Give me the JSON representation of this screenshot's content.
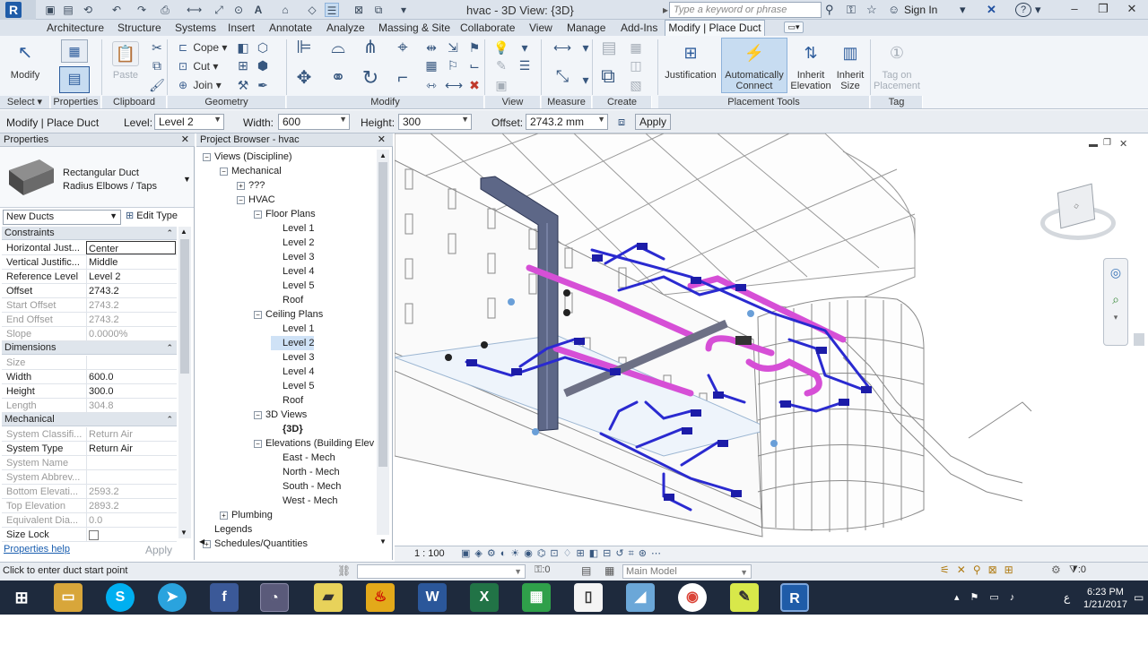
{
  "titlebar": {
    "title": "hvac - 3D View: {3D}",
    "search_placeholder": "Type a keyword or phrase",
    "signin": "Sign In",
    "help": "?"
  },
  "tabs": [
    "Architecture",
    "Structure",
    "Systems",
    "Insert",
    "Annotate",
    "Analyze",
    "Massing & Site",
    "Collaborate",
    "View",
    "Manage",
    "Add-Ins",
    "Modify | Place Duct"
  ],
  "ribbon": {
    "select": {
      "modify": "Modify",
      "panel": "Select"
    },
    "properties_panel": "Properties",
    "clipboard": {
      "paste": "Paste",
      "panel": "Clipboard"
    },
    "geometry": {
      "cope": "Cope",
      "cut": "Cut",
      "join": "Join",
      "panel": "Geometry"
    },
    "modify_panel": "Modify",
    "view_panel": "View",
    "measure_panel": "Measure",
    "create_panel": "Create",
    "placement": {
      "justification": "Justification",
      "auto_connect_1": "Automatically",
      "auto_connect_2": "Connect",
      "inherit_elev_1": "Inherit",
      "inherit_elev_2": "Elevation",
      "inherit_size_1": "Inherit",
      "inherit_size_2": "Size",
      "panel": "Placement Tools"
    },
    "tag": {
      "tag_1": "Tag on",
      "tag_2": "Placement",
      "panel": "Tag"
    }
  },
  "options": {
    "context": "Modify | Place Duct",
    "level_label": "Level:",
    "level": "Level 2",
    "width_label": "Width:",
    "width": "600",
    "height_label": "Height:",
    "height": "300",
    "offset_label": "Offset:",
    "offset": "2743.2 mm",
    "apply": "Apply"
  },
  "properties": {
    "title": "Properties",
    "type_line1": "Rectangular Duct",
    "type_line2": "Radius Elbows / Taps",
    "instance": "New Ducts",
    "edit_type": "Edit Type",
    "groups": [
      {
        "name": "Constraints",
        "rows": [
          {
            "k": "Horizontal Just...",
            "v": "Center"
          },
          {
            "k": "Vertical Justific...",
            "v": "Middle"
          },
          {
            "k": "Reference Level",
            "v": "Level 2"
          },
          {
            "k": "Offset",
            "v": "2743.2"
          },
          {
            "k": "Start Offset",
            "v": "2743.2"
          },
          {
            "k": "End Offset",
            "v": "2743.2"
          },
          {
            "k": "Slope",
            "v": "0.0000%"
          }
        ]
      },
      {
        "name": "Dimensions",
        "rows": [
          {
            "k": "Size",
            "v": ""
          },
          {
            "k": "Width",
            "v": "600.0"
          },
          {
            "k": "Height",
            "v": "300.0"
          },
          {
            "k": "Length",
            "v": "304.8"
          }
        ]
      },
      {
        "name": "Mechanical",
        "rows": [
          {
            "k": "System Classifi...",
            "v": "Return Air"
          },
          {
            "k": "System Type",
            "v": "Return Air"
          },
          {
            "k": "System Name",
            "v": ""
          },
          {
            "k": "System Abbrev...",
            "v": ""
          },
          {
            "k": "Bottom Elevati...",
            "v": "2593.2"
          },
          {
            "k": "Top Elevation",
            "v": "2893.2"
          },
          {
            "k": "Equivalent Dia...",
            "v": "0.0"
          },
          {
            "k": "Size Lock",
            "v": ""
          }
        ]
      }
    ],
    "help": "Properties help",
    "apply": "Apply"
  },
  "browser": {
    "title": "Project Browser - hvac",
    "nodes": [
      {
        "label": "Views (Discipline)",
        "indent": 0,
        "toggle": "-"
      },
      {
        "label": "Mechanical",
        "indent": 1,
        "toggle": "-"
      },
      {
        "label": "???",
        "indent": 2,
        "toggle": "+"
      },
      {
        "label": "HVAC",
        "indent": 2,
        "toggle": "-"
      },
      {
        "label": "Floor Plans",
        "indent": 3,
        "toggle": "-"
      },
      {
        "label": "Level 1",
        "indent": 4,
        "toggle": ""
      },
      {
        "label": "Level 2",
        "indent": 4,
        "toggle": ""
      },
      {
        "label": "Level 3",
        "indent": 4,
        "toggle": ""
      },
      {
        "label": "Level 4",
        "indent": 4,
        "toggle": ""
      },
      {
        "label": "Level 5",
        "indent": 4,
        "toggle": ""
      },
      {
        "label": "Roof",
        "indent": 4,
        "toggle": ""
      },
      {
        "label": "Ceiling Plans",
        "indent": 3,
        "toggle": "-"
      },
      {
        "label": "Level 1",
        "indent": 4,
        "toggle": ""
      },
      {
        "label": "Level 2",
        "indent": 4,
        "toggle": "",
        "selected": true
      },
      {
        "label": "Level 3",
        "indent": 4,
        "toggle": ""
      },
      {
        "label": "Level 4",
        "indent": 4,
        "toggle": ""
      },
      {
        "label": "Level 5",
        "indent": 4,
        "toggle": ""
      },
      {
        "label": "Roof",
        "indent": 4,
        "toggle": ""
      },
      {
        "label": "3D Views",
        "indent": 3,
        "toggle": "-"
      },
      {
        "label": "{3D}",
        "indent": 4,
        "toggle": "",
        "bold": true
      },
      {
        "label": "Elevations (Building Elev",
        "indent": 3,
        "toggle": "-"
      },
      {
        "label": "East - Mech",
        "indent": 4,
        "toggle": ""
      },
      {
        "label": "North - Mech",
        "indent": 4,
        "toggle": ""
      },
      {
        "label": "South - Mech",
        "indent": 4,
        "toggle": ""
      },
      {
        "label": "West - Mech",
        "indent": 4,
        "toggle": ""
      },
      {
        "label": "Plumbing",
        "indent": 1,
        "toggle": "+"
      },
      {
        "label": "Legends",
        "indent": 0,
        "toggle": ""
      },
      {
        "label": "Schedules/Quantities",
        "indent": 0,
        "toggle": "+"
      }
    ]
  },
  "viewport": {
    "scale": "1 : 100",
    "duct_color": "#2a2ad0",
    "return_color": "#d64fd6",
    "riser_color": "#5d6787"
  },
  "status": {
    "text": "Click to enter duct start point",
    "count": ":0",
    "model": "Main Model",
    "filter": ":0"
  },
  "taskbar": {
    "time": "6:23 PM",
    "date": "1/21/2017",
    "lang": "ع"
  }
}
